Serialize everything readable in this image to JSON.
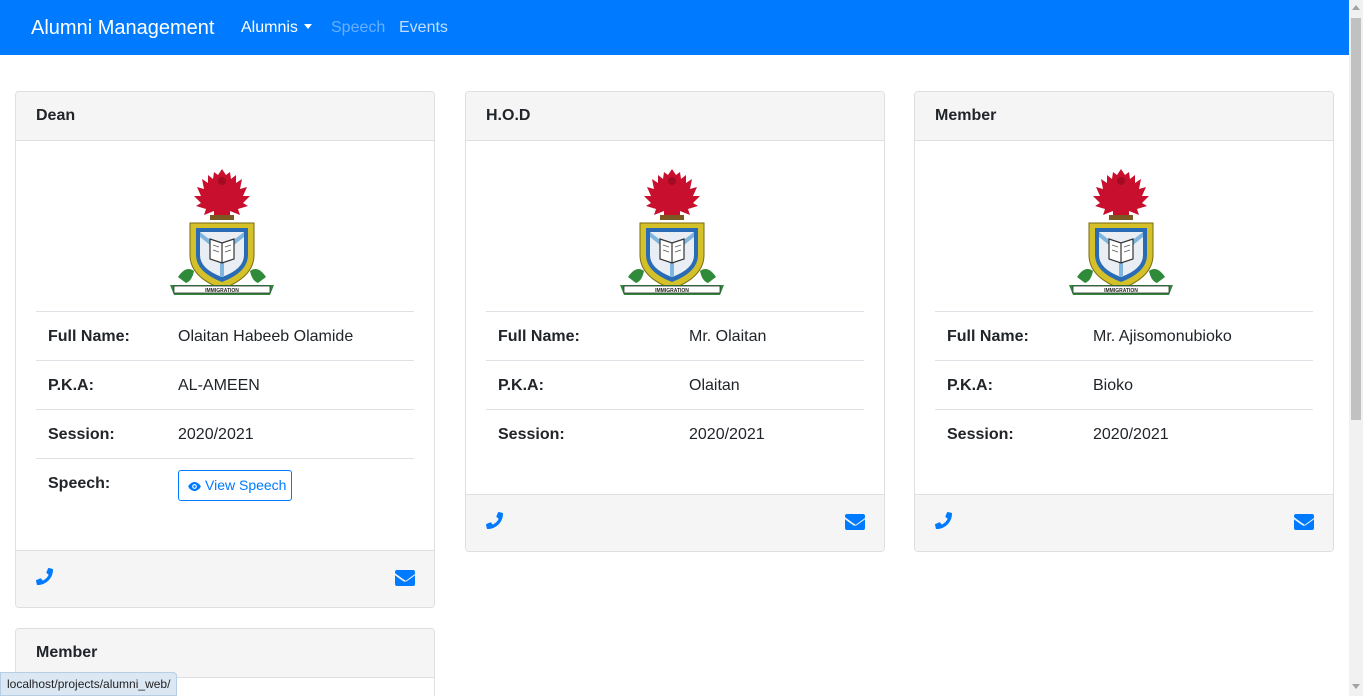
{
  "navbar": {
    "brand": "Alumni Management",
    "links": [
      {
        "label": "Alumnis",
        "dropdown": true,
        "state": "active"
      },
      {
        "label": "Speech",
        "state": "disabled"
      },
      {
        "label": "Events",
        "state": "normal"
      }
    ]
  },
  "colors": {
    "primary": "#007bff",
    "card_header_bg": "#f5f5f5"
  },
  "cards": [
    {
      "title": "Dean",
      "emblem_icon": "immigration-emblem",
      "emblem_text": "IMMIGRATION",
      "rows": [
        {
          "label": "Full Name:",
          "value": "Olaitan Habeeb Olamide"
        },
        {
          "label": "P.K.A:",
          "value": "AL-AMEEN"
        },
        {
          "label": "Session:",
          "value": "2020/2021"
        },
        {
          "label": "Speech:",
          "button": "View Speech"
        }
      ]
    },
    {
      "title": "H.O.D",
      "emblem_icon": "immigration-emblem",
      "emblem_text": "IMMIGRATION",
      "rows": [
        {
          "label": "Full Name:",
          "value": "Mr. Olaitan"
        },
        {
          "label": "P.K.A:",
          "value": "Olaitan"
        },
        {
          "label": "Session:",
          "value": "2020/2021"
        }
      ]
    },
    {
      "title": "Member",
      "emblem_icon": "immigration-emblem",
      "emblem_text": "IMMIGRATION",
      "rows": [
        {
          "label": "Full Name:",
          "value": "Mr. Ajisomonubioko"
        },
        {
          "label": "P.K.A:",
          "value": "Bioko"
        },
        {
          "label": "Session:",
          "value": "2020/2021"
        }
      ]
    },
    {
      "title": "Member"
    }
  ],
  "status_bar": {
    "url": "localhost/projects/alumni_web/"
  }
}
